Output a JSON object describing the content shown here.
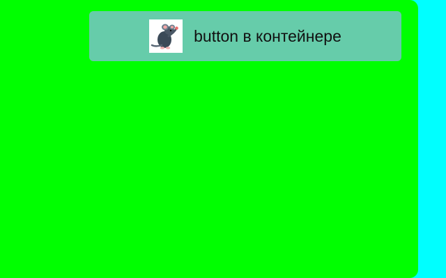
{
  "container": {
    "background": "#00ff00",
    "outer_background": "#00ffff"
  },
  "button": {
    "label": "button в контейнере",
    "icon": "rat-icon",
    "background": "#66ccaa"
  }
}
